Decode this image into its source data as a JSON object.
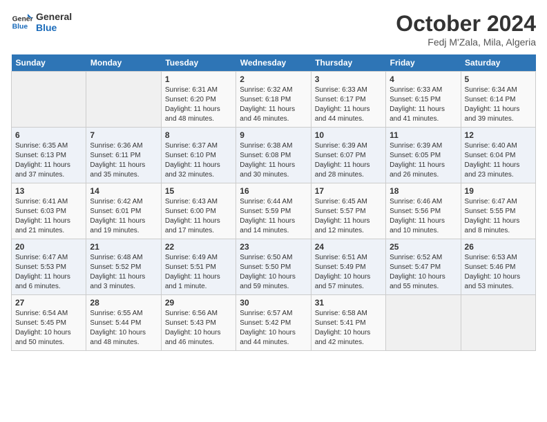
{
  "logo": {
    "line1": "General",
    "line2": "Blue"
  },
  "title": "October 2024",
  "subtitle": "Fedj M'Zala, Mila, Algeria",
  "headers": [
    "Sunday",
    "Monday",
    "Tuesday",
    "Wednesday",
    "Thursday",
    "Friday",
    "Saturday"
  ],
  "weeks": [
    [
      {
        "day": "",
        "info": ""
      },
      {
        "day": "",
        "info": ""
      },
      {
        "day": "1",
        "info": "Sunrise: 6:31 AM\nSunset: 6:20 PM\nDaylight: 11 hours and 48 minutes."
      },
      {
        "day": "2",
        "info": "Sunrise: 6:32 AM\nSunset: 6:18 PM\nDaylight: 11 hours and 46 minutes."
      },
      {
        "day": "3",
        "info": "Sunrise: 6:33 AM\nSunset: 6:17 PM\nDaylight: 11 hours and 44 minutes."
      },
      {
        "day": "4",
        "info": "Sunrise: 6:33 AM\nSunset: 6:15 PM\nDaylight: 11 hours and 41 minutes."
      },
      {
        "day": "5",
        "info": "Sunrise: 6:34 AM\nSunset: 6:14 PM\nDaylight: 11 hours and 39 minutes."
      }
    ],
    [
      {
        "day": "6",
        "info": "Sunrise: 6:35 AM\nSunset: 6:13 PM\nDaylight: 11 hours and 37 minutes."
      },
      {
        "day": "7",
        "info": "Sunrise: 6:36 AM\nSunset: 6:11 PM\nDaylight: 11 hours and 35 minutes."
      },
      {
        "day": "8",
        "info": "Sunrise: 6:37 AM\nSunset: 6:10 PM\nDaylight: 11 hours and 32 minutes."
      },
      {
        "day": "9",
        "info": "Sunrise: 6:38 AM\nSunset: 6:08 PM\nDaylight: 11 hours and 30 minutes."
      },
      {
        "day": "10",
        "info": "Sunrise: 6:39 AM\nSunset: 6:07 PM\nDaylight: 11 hours and 28 minutes."
      },
      {
        "day": "11",
        "info": "Sunrise: 6:39 AM\nSunset: 6:05 PM\nDaylight: 11 hours and 26 minutes."
      },
      {
        "day": "12",
        "info": "Sunrise: 6:40 AM\nSunset: 6:04 PM\nDaylight: 11 hours and 23 minutes."
      }
    ],
    [
      {
        "day": "13",
        "info": "Sunrise: 6:41 AM\nSunset: 6:03 PM\nDaylight: 11 hours and 21 minutes."
      },
      {
        "day": "14",
        "info": "Sunrise: 6:42 AM\nSunset: 6:01 PM\nDaylight: 11 hours and 19 minutes."
      },
      {
        "day": "15",
        "info": "Sunrise: 6:43 AM\nSunset: 6:00 PM\nDaylight: 11 hours and 17 minutes."
      },
      {
        "day": "16",
        "info": "Sunrise: 6:44 AM\nSunset: 5:59 PM\nDaylight: 11 hours and 14 minutes."
      },
      {
        "day": "17",
        "info": "Sunrise: 6:45 AM\nSunset: 5:57 PM\nDaylight: 11 hours and 12 minutes."
      },
      {
        "day": "18",
        "info": "Sunrise: 6:46 AM\nSunset: 5:56 PM\nDaylight: 11 hours and 10 minutes."
      },
      {
        "day": "19",
        "info": "Sunrise: 6:47 AM\nSunset: 5:55 PM\nDaylight: 11 hours and 8 minutes."
      }
    ],
    [
      {
        "day": "20",
        "info": "Sunrise: 6:47 AM\nSunset: 5:53 PM\nDaylight: 11 hours and 6 minutes."
      },
      {
        "day": "21",
        "info": "Sunrise: 6:48 AM\nSunset: 5:52 PM\nDaylight: 11 hours and 3 minutes."
      },
      {
        "day": "22",
        "info": "Sunrise: 6:49 AM\nSunset: 5:51 PM\nDaylight: 11 hours and 1 minute."
      },
      {
        "day": "23",
        "info": "Sunrise: 6:50 AM\nSunset: 5:50 PM\nDaylight: 10 hours and 59 minutes."
      },
      {
        "day": "24",
        "info": "Sunrise: 6:51 AM\nSunset: 5:49 PM\nDaylight: 10 hours and 57 minutes."
      },
      {
        "day": "25",
        "info": "Sunrise: 6:52 AM\nSunset: 5:47 PM\nDaylight: 10 hours and 55 minutes."
      },
      {
        "day": "26",
        "info": "Sunrise: 6:53 AM\nSunset: 5:46 PM\nDaylight: 10 hours and 53 minutes."
      }
    ],
    [
      {
        "day": "27",
        "info": "Sunrise: 6:54 AM\nSunset: 5:45 PM\nDaylight: 10 hours and 50 minutes."
      },
      {
        "day": "28",
        "info": "Sunrise: 6:55 AM\nSunset: 5:44 PM\nDaylight: 10 hours and 48 minutes."
      },
      {
        "day": "29",
        "info": "Sunrise: 6:56 AM\nSunset: 5:43 PM\nDaylight: 10 hours and 46 minutes."
      },
      {
        "day": "30",
        "info": "Sunrise: 6:57 AM\nSunset: 5:42 PM\nDaylight: 10 hours and 44 minutes."
      },
      {
        "day": "31",
        "info": "Sunrise: 6:58 AM\nSunset: 5:41 PM\nDaylight: 10 hours and 42 minutes."
      },
      {
        "day": "",
        "info": ""
      },
      {
        "day": "",
        "info": ""
      }
    ]
  ]
}
